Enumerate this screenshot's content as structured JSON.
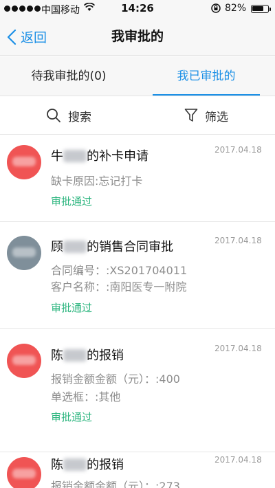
{
  "status_bar": {
    "carrier": "中国移动",
    "time": "14:26",
    "battery": "82%",
    "battery_level": 0.82
  },
  "nav": {
    "back_label": "返回",
    "title": "我审批的"
  },
  "tabs": [
    {
      "label": "待我审批的(0)",
      "active": false
    },
    {
      "label": "我已审批的",
      "active": true
    }
  ],
  "tools": {
    "search_label": "搜索",
    "filter_label": "筛选"
  },
  "items": [
    {
      "avatar_color": "#f05454",
      "title_prefix": "牛",
      "title_suffix": "的补卡申请",
      "date": "2017.04.18",
      "lines": [
        "缺卡原因:忘记打卡"
      ],
      "status": "审批通过"
    },
    {
      "avatar_color": "#7f8f9a",
      "title_prefix": "顾",
      "title_suffix": "的销售合同审批",
      "date": "2017.04.18",
      "lines": [
        "合同编号：:XS201704011",
        "客户名称：:南阳医专一附院"
      ],
      "status": "审批通过"
    },
    {
      "avatar_color": "#f05454",
      "title_prefix": "陈",
      "title_suffix": "的报销",
      "date": "2017.04.18",
      "lines": [
        "报销金额金额（元）：:400",
        "单选框：:其他"
      ],
      "status": "审批通过"
    },
    {
      "avatar_color": "#f05454",
      "title_prefix": "陈",
      "title_suffix": "的报销",
      "date": "2017.04.18",
      "lines": [
        "报销金额金额（元）：:273"
      ],
      "status": ""
    }
  ]
}
